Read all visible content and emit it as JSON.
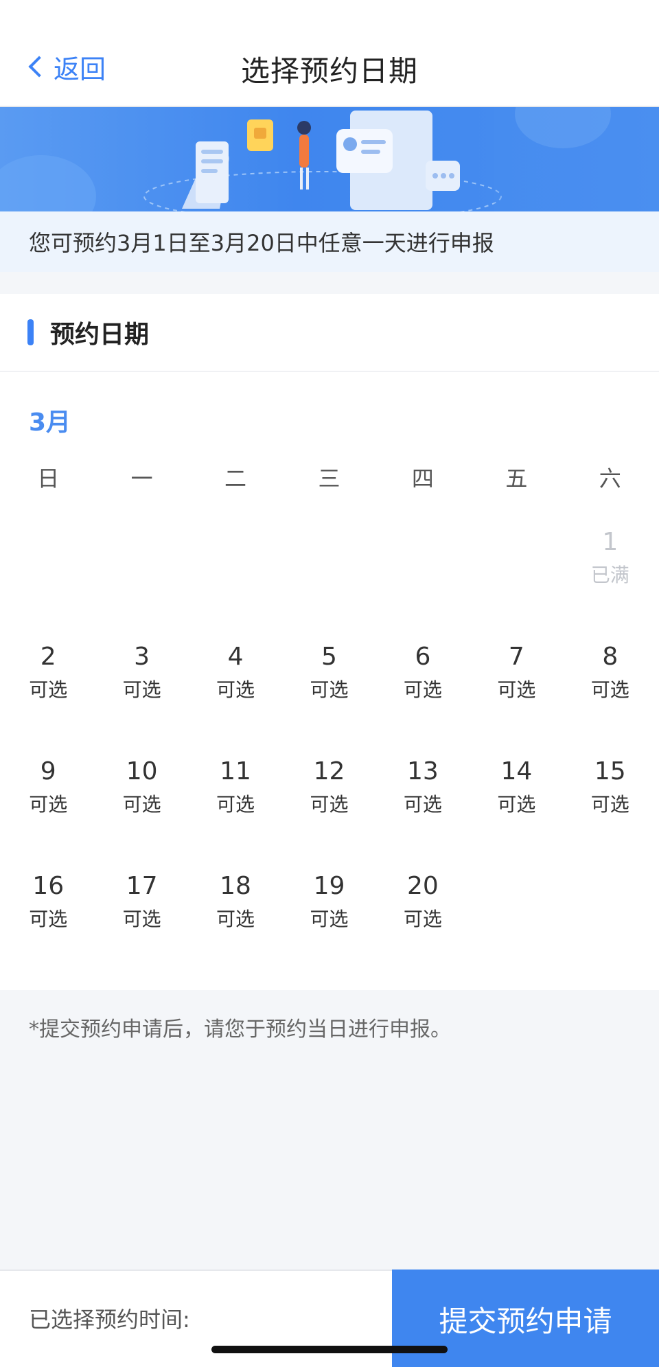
{
  "nav": {
    "back_label": "返回",
    "title": "选择预约日期"
  },
  "info": {
    "text": "您可预约3月1日至3月20日中任意一天进行申报"
  },
  "section": {
    "title": "预约日期"
  },
  "calendar": {
    "month": "3月",
    "weekdays": [
      "日",
      "一",
      "二",
      "三",
      "四",
      "五",
      "六"
    ],
    "leading_blanks": 6,
    "days": [
      {
        "day": "1",
        "status": "已满",
        "available": false
      },
      {
        "day": "2",
        "status": "可选",
        "available": true
      },
      {
        "day": "3",
        "status": "可选",
        "available": true
      },
      {
        "day": "4",
        "status": "可选",
        "available": true
      },
      {
        "day": "5",
        "status": "可选",
        "available": true
      },
      {
        "day": "6",
        "status": "可选",
        "available": true
      },
      {
        "day": "7",
        "status": "可选",
        "available": true
      },
      {
        "day": "8",
        "status": "可选",
        "available": true
      },
      {
        "day": "9",
        "status": "可选",
        "available": true
      },
      {
        "day": "10",
        "status": "可选",
        "available": true
      },
      {
        "day": "11",
        "status": "可选",
        "available": true
      },
      {
        "day": "12",
        "status": "可选",
        "available": true
      },
      {
        "day": "13",
        "status": "可选",
        "available": true
      },
      {
        "day": "14",
        "status": "可选",
        "available": true
      },
      {
        "day": "15",
        "status": "可选",
        "available": true
      },
      {
        "day": "16",
        "status": "可选",
        "available": true
      },
      {
        "day": "17",
        "status": "可选",
        "available": true
      },
      {
        "day": "18",
        "status": "可选",
        "available": true
      },
      {
        "day": "19",
        "status": "可选",
        "available": true
      },
      {
        "day": "20",
        "status": "可选",
        "available": true
      }
    ]
  },
  "note": {
    "text": "*提交预约申请后，请您于预约当日进行申报。"
  },
  "footer": {
    "selected_label": "已选择预约时间:",
    "submit_label": "提交预约申请"
  },
  "colors": {
    "accent": "#3c82f6",
    "full_day": "#c3c6cc"
  },
  "icons": {
    "back": "chevron-left-icon"
  }
}
